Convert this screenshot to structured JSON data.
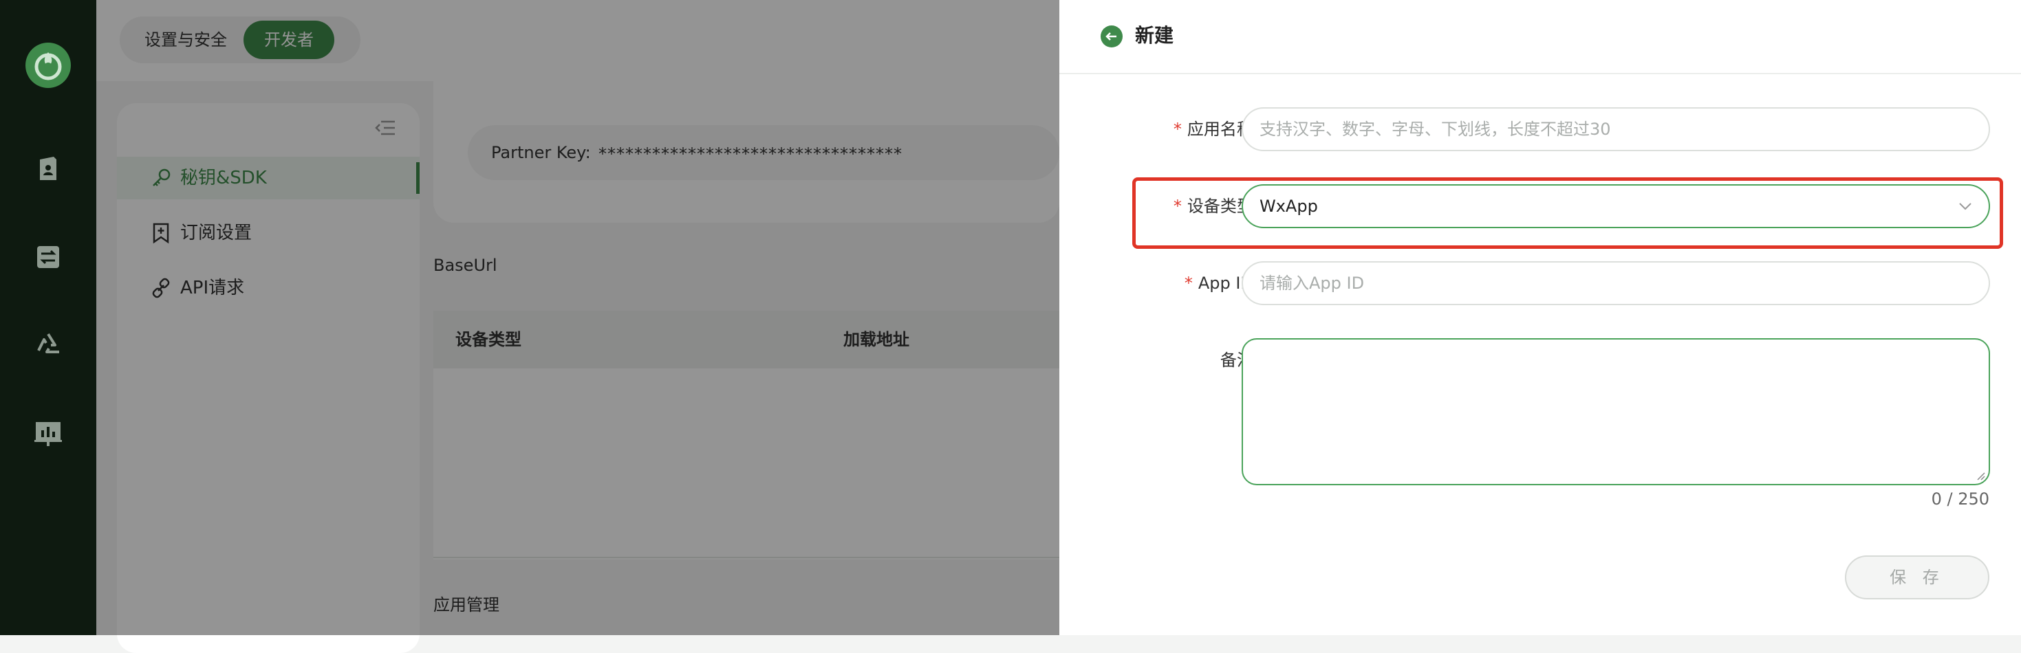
{
  "header": {
    "tabs": [
      {
        "label": "设置与安全",
        "active": false
      },
      {
        "label": "开发者",
        "active": true
      }
    ]
  },
  "sidebar": {
    "items": [
      {
        "label": "秘钥&SDK",
        "icon": "key-icon",
        "active": true
      },
      {
        "label": "订阅设置",
        "icon": "bookmark-add-icon",
        "active": false
      },
      {
        "label": "API请求",
        "icon": "link-icon",
        "active": false
      }
    ]
  },
  "main": {
    "partner_key_label": "Partner Key:",
    "partner_key_value": "**********************************",
    "baseurl_label": "BaseUrl",
    "table_headers": [
      "设备类型",
      "加载地址"
    ],
    "app_management_label": "应用管理"
  },
  "drawer": {
    "title": "新建",
    "fields": {
      "app_name": {
        "label": "应用名称",
        "placeholder": "支持汉字、数字、字母、下划线，长度不超过30",
        "required": true
      },
      "device_type": {
        "label": "设备类型",
        "value": "WxApp",
        "required": true
      },
      "app_id": {
        "label": "App ID",
        "placeholder": "请输入App ID",
        "required": true
      },
      "remark": {
        "label": "备注",
        "value": "",
        "counter": "0 / 250"
      }
    },
    "label_suffix": ":",
    "required_mark": "*",
    "save_label": "保 存"
  },
  "colors": {
    "brand_green": "#3f8a4b",
    "focus_green": "#4aa35a",
    "highlight_red": "#e03426",
    "required_red": "#e03c31",
    "rail_dark": "#0e1a10"
  }
}
